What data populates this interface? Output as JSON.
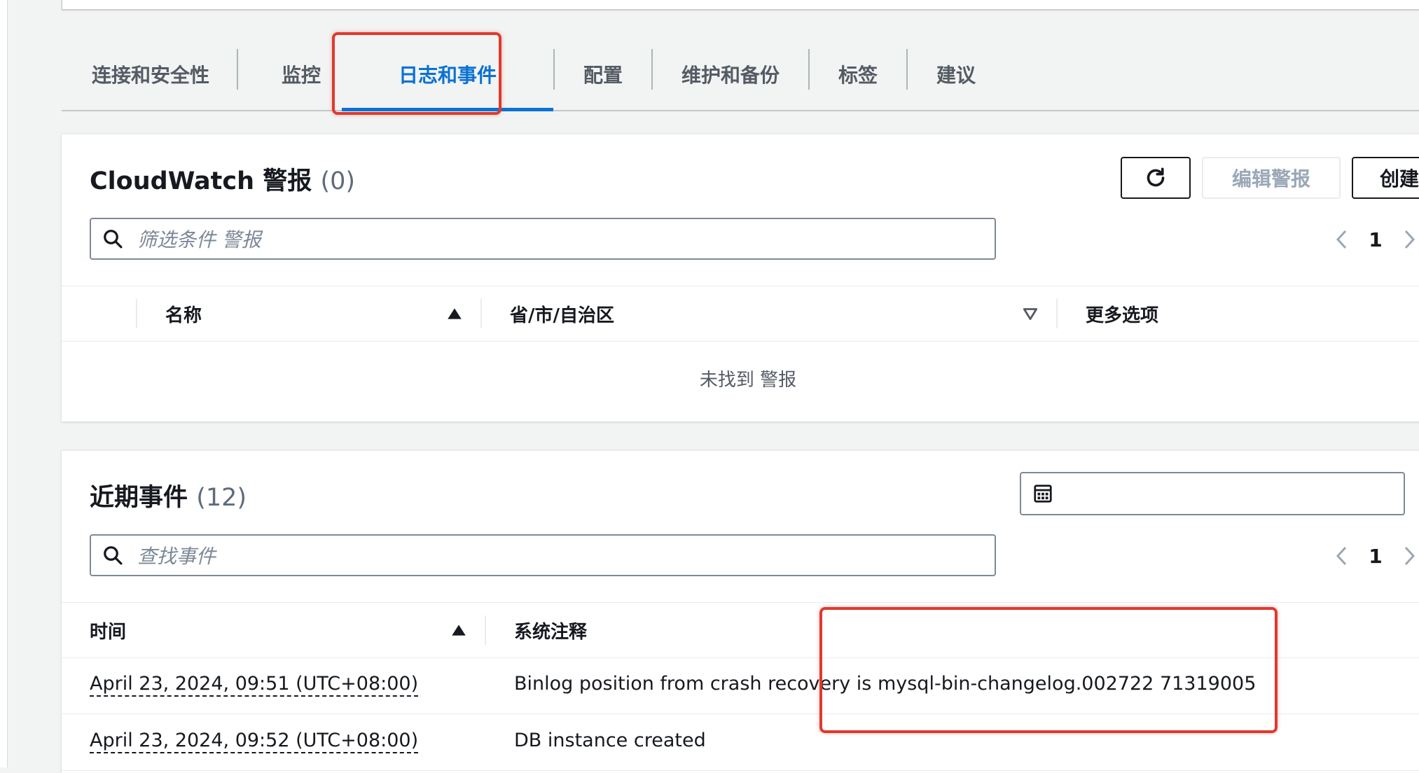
{
  "tabs": [
    {
      "label": "连接和安全性"
    },
    {
      "label": "监控"
    },
    {
      "label": "日志和事件"
    },
    {
      "label": "配置"
    },
    {
      "label": "维护和备份"
    },
    {
      "label": "标签"
    },
    {
      "label": "建议"
    }
  ],
  "active_tab": "日志和事件",
  "alarms": {
    "title": "CloudWatch 警报",
    "count": "(0)",
    "buttons": {
      "refresh_icon": "refresh-icon",
      "edit": "编辑警报",
      "create": "创建"
    },
    "search_placeholder": "筛选条件 警报",
    "page": "1",
    "columns": [
      "名称",
      "省/市/自治区",
      "更多选项"
    ],
    "empty_message": "未找到 警报"
  },
  "events": {
    "title": "近期事件",
    "count": "(12)",
    "search_placeholder": "查找事件",
    "page": "1",
    "columns": [
      "时间",
      "系统注释"
    ],
    "rows": [
      {
        "time": "April 23, 2024, 09:51 (UTC+08:00)",
        "message": "Binlog position from crash recovery is mysql-bin-changelog.002722 71319005"
      },
      {
        "time": "April 23, 2024, 09:52 (UTC+08:00)",
        "message": "DB instance created"
      }
    ]
  },
  "colors": {
    "accent": "#0972d3",
    "highlight": "#e0392e",
    "text": "#16191f"
  }
}
